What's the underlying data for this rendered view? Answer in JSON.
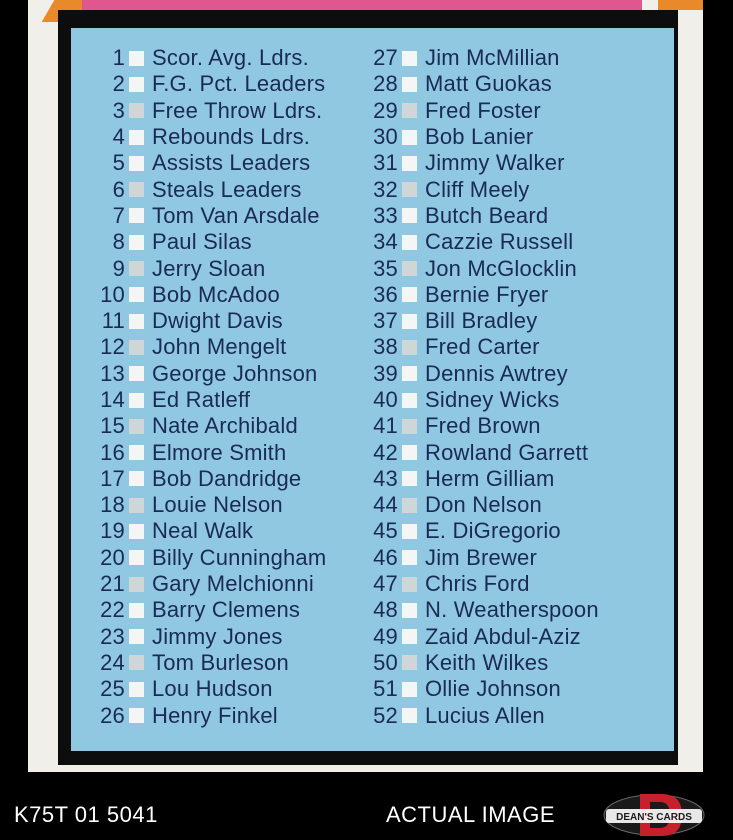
{
  "checklist": {
    "left": [
      {
        "num": "1",
        "name": "Scor. Avg. Ldrs."
      },
      {
        "num": "2",
        "name": "F.G. Pct. Leaders"
      },
      {
        "num": "3",
        "name": "Free Throw Ldrs."
      },
      {
        "num": "4",
        "name": "Rebounds Ldrs."
      },
      {
        "num": "5",
        "name": "Assists Leaders"
      },
      {
        "num": "6",
        "name": "Steals Leaders"
      },
      {
        "num": "7",
        "name": "Tom Van Arsdale"
      },
      {
        "num": "8",
        "name": "Paul Silas"
      },
      {
        "num": "9",
        "name": "Jerry Sloan"
      },
      {
        "num": "10",
        "name": "Bob McAdoo"
      },
      {
        "num": "11",
        "name": "Dwight Davis"
      },
      {
        "num": "12",
        "name": "John Mengelt"
      },
      {
        "num": "13",
        "name": "George Johnson"
      },
      {
        "num": "14",
        "name": "Ed Ratleff"
      },
      {
        "num": "15",
        "name": "Nate Archibald"
      },
      {
        "num": "16",
        "name": "Elmore Smith"
      },
      {
        "num": "17",
        "name": "Bob Dandridge"
      },
      {
        "num": "18",
        "name": "Louie Nelson"
      },
      {
        "num": "19",
        "name": "Neal Walk"
      },
      {
        "num": "20",
        "name": "Billy Cunningham"
      },
      {
        "num": "21",
        "name": "Gary Melchionni"
      },
      {
        "num": "22",
        "name": "Barry Clemens"
      },
      {
        "num": "23",
        "name": "Jimmy Jones"
      },
      {
        "num": "24",
        "name": "Tom Burleson"
      },
      {
        "num": "25",
        "name": "Lou Hudson"
      },
      {
        "num": "26",
        "name": "Henry Finkel"
      }
    ],
    "right": [
      {
        "num": "27",
        "name": "Jim McMillian"
      },
      {
        "num": "28",
        "name": "Matt Guokas"
      },
      {
        "num": "29",
        "name": "Fred Foster"
      },
      {
        "num": "30",
        "name": "Bob Lanier"
      },
      {
        "num": "31",
        "name": "Jimmy Walker"
      },
      {
        "num": "32",
        "name": "Cliff Meely"
      },
      {
        "num": "33",
        "name": "Butch Beard"
      },
      {
        "num": "34",
        "name": "Cazzie Russell"
      },
      {
        "num": "35",
        "name": "Jon McGlocklin"
      },
      {
        "num": "36",
        "name": "Bernie Fryer"
      },
      {
        "num": "37",
        "name": "Bill Bradley"
      },
      {
        "num": "38",
        "name": "Fred Carter"
      },
      {
        "num": "39",
        "name": "Dennis Awtrey"
      },
      {
        "num": "40",
        "name": "Sidney Wicks"
      },
      {
        "num": "41",
        "name": "Fred Brown"
      },
      {
        "num": "42",
        "name": "Rowland Garrett"
      },
      {
        "num": "43",
        "name": "Herm Gilliam"
      },
      {
        "num": "44",
        "name": "Don Nelson"
      },
      {
        "num": "45",
        "name": "E. DiGregorio"
      },
      {
        "num": "46",
        "name": "Jim Brewer"
      },
      {
        "num": "47",
        "name": "Chris Ford"
      },
      {
        "num": "48",
        "name": "N. Weatherspoon"
      },
      {
        "num": "49",
        "name": "Zaid Abdul-Aziz"
      },
      {
        "num": "50",
        "name": "Keith Wilkes"
      },
      {
        "num": "51",
        "name": "Ollie Johnson"
      },
      {
        "num": "52",
        "name": "Lucius Allen"
      }
    ]
  },
  "footer": {
    "code": "K75T 01 5041",
    "label": "ACTUAL IMAGE",
    "logo_text": "DEAN'S CARDS"
  },
  "colors": {
    "panel": "#8fc8e0",
    "text": "#1b2a55",
    "pink": "#e0568f",
    "orange": "#e98a2a",
    "logo_red": "#c8202a"
  }
}
